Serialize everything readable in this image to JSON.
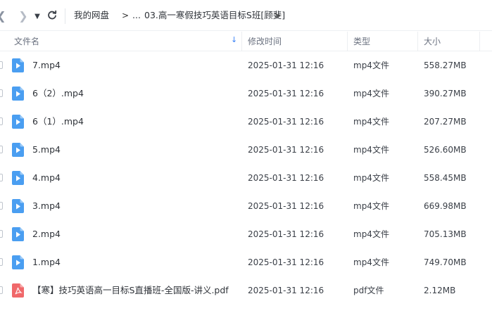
{
  "toolbar": {
    "back_glyph": "❮",
    "forward_glyph": "❯",
    "dropdown_glyph": "▼",
    "refresh_glyph": "↻"
  },
  "breadcrumb": {
    "root": "我的网盘",
    "sep": ">",
    "ellipsis": "...",
    "current": "03.高一寒假技巧英语目标S班[顾斐]"
  },
  "columns": {
    "name": "文件名",
    "modified": "修改时间",
    "type": "类型",
    "size": "大小"
  },
  "sort": {
    "column": "name",
    "direction": "descending",
    "glyph": "↓",
    "color": "#3b82f6"
  },
  "colors": {
    "video_icon": "#4a9ef1",
    "pdf_icon": "#f0686a"
  },
  "files": [
    {
      "name": "7.mp4",
      "modified": "2025-01-31 12:16",
      "type": "mp4文件",
      "size": "558.27MB",
      "icon": "video-file-icon"
    },
    {
      "name": "6（2）.mp4",
      "modified": "2025-01-31 12:16",
      "type": "mp4文件",
      "size": "390.27MB",
      "icon": "video-file-icon"
    },
    {
      "name": "6（1）.mp4",
      "modified": "2025-01-31 12:16",
      "type": "mp4文件",
      "size": "207.27MB",
      "icon": "video-file-icon"
    },
    {
      "name": "5.mp4",
      "modified": "2025-01-31 12:16",
      "type": "mp4文件",
      "size": "526.60MB",
      "icon": "video-file-icon"
    },
    {
      "name": "4.mp4",
      "modified": "2025-01-31 12:16",
      "type": "mp4文件",
      "size": "558.45MB",
      "icon": "video-file-icon"
    },
    {
      "name": "3.mp4",
      "modified": "2025-01-31 12:16",
      "type": "mp4文件",
      "size": "669.98MB",
      "icon": "video-file-icon"
    },
    {
      "name": "2.mp4",
      "modified": "2025-01-31 12:16",
      "type": "mp4文件",
      "size": "705.13MB",
      "icon": "video-file-icon"
    },
    {
      "name": "1.mp4",
      "modified": "2025-01-31 12:16",
      "type": "mp4文件",
      "size": "749.70MB",
      "icon": "video-file-icon"
    },
    {
      "name": "【寒】技巧英语高一目标S直播班-全国版-讲义.pdf",
      "modified": "2025-01-31 12:16",
      "type": "pdf文件",
      "size": "2.12MB",
      "icon": "pdf-file-icon"
    }
  ]
}
